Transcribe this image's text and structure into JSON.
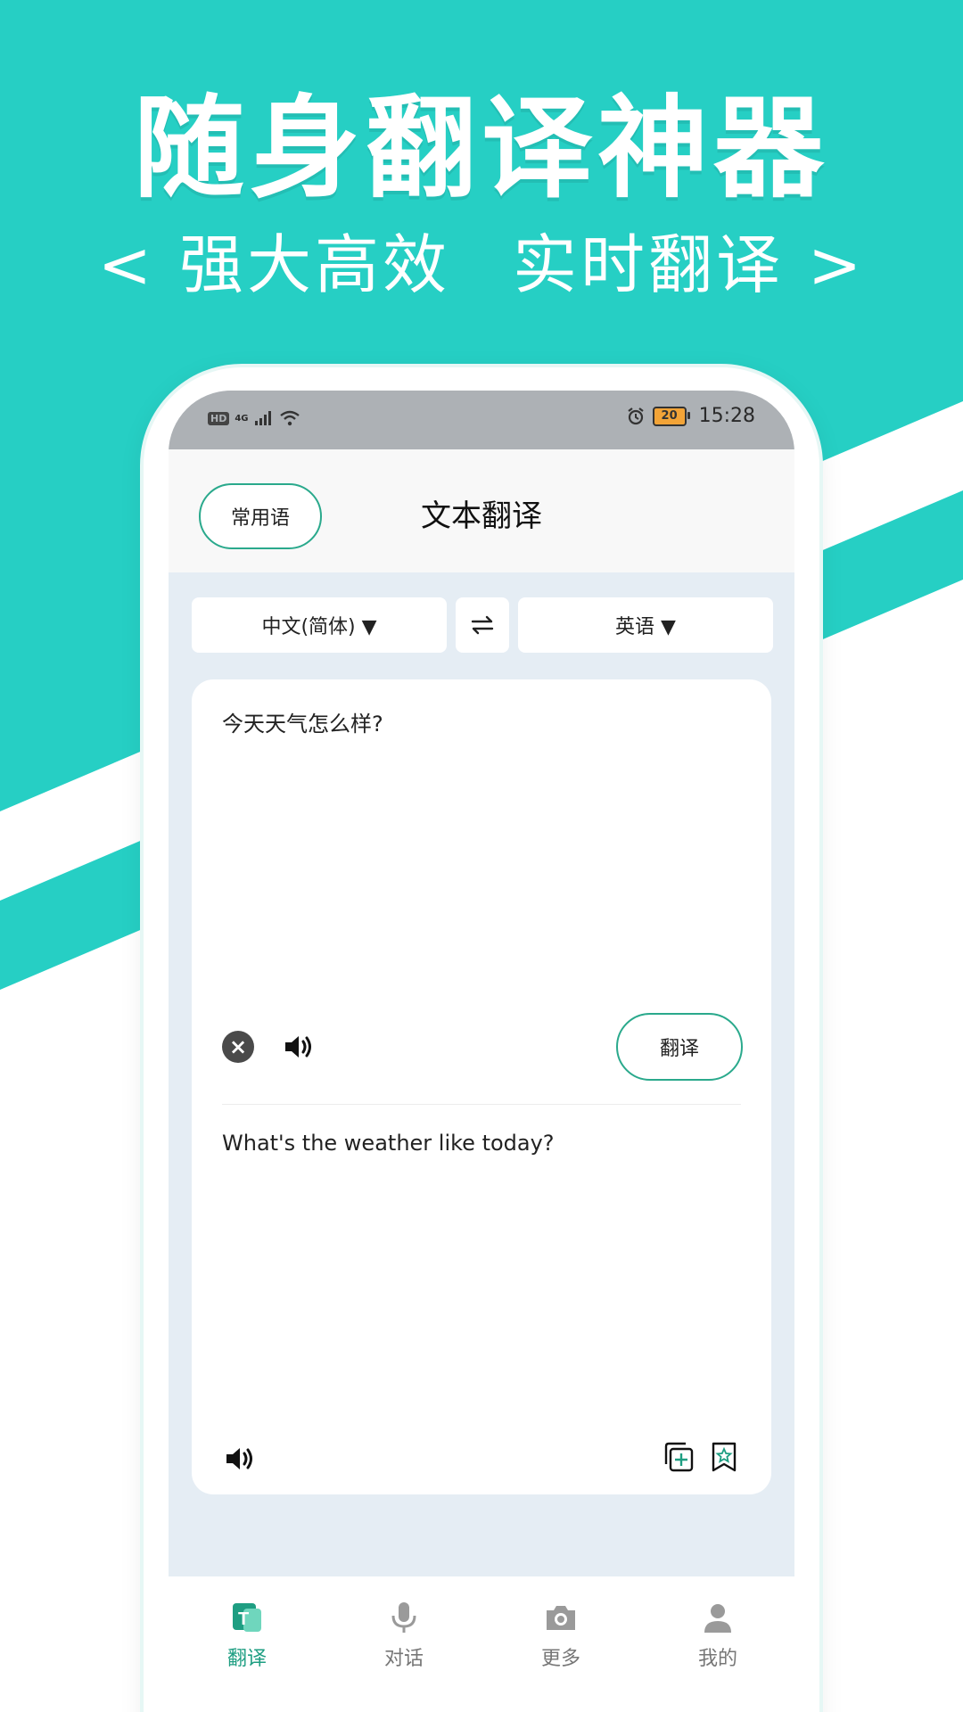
{
  "promo": {
    "headline": "随身翻译神器",
    "sub_left": "< 强大高效",
    "sub_right": "实时翻译 >"
  },
  "colors": {
    "brand_teal": "#26cfc4",
    "accent_green": "#2aa98c",
    "screen_bg": "#e5edf4"
  },
  "status_bar": {
    "left": [
      "HD",
      "4G",
      "signal-icon",
      "wifi-icon"
    ],
    "battery": "20",
    "time": "15:28"
  },
  "app_bar": {
    "phrase_button": "常用语",
    "title": "文本翻译"
  },
  "languages": {
    "source": "中文(简体) ▼",
    "swap_icon": "swap-arrows-icon",
    "target": "英语 ▼"
  },
  "translator": {
    "source_text": "今天天气怎么样?",
    "translate_button": "翻译",
    "result_text": "What's the weather like today?"
  },
  "tabs": [
    {
      "label": "翻译",
      "icon": "translate-icon",
      "active": true
    },
    {
      "label": "对话",
      "icon": "microphone-icon",
      "active": false
    },
    {
      "label": "更多",
      "icon": "camera-icon",
      "active": false
    },
    {
      "label": "我的",
      "icon": "person-icon",
      "active": false
    }
  ]
}
